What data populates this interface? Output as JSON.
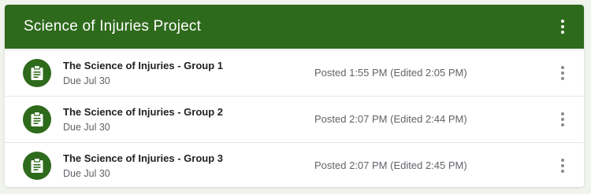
{
  "header": {
    "title": "Science of Injuries Project",
    "menu_icon": "more-vert-icon"
  },
  "colors": {
    "brand_green": "#2e6a1c",
    "background": "#f0f4ec"
  },
  "assignments": [
    {
      "title": "The Science of Injuries - Group 1",
      "due": "Due Jul 30",
      "posted": "Posted 1:55 PM (Edited 2:05 PM)",
      "icon": "assignment-icon"
    },
    {
      "title": "The Science of Injuries - Group 2",
      "due": "Due Jul 30",
      "posted": "Posted 2:07 PM (Edited 2:44 PM)",
      "icon": "assignment-icon"
    },
    {
      "title": "The Science of Injuries - Group 3",
      "due": "Due Jul 30",
      "posted": "Posted 2:07 PM (Edited 2:45 PM)",
      "icon": "assignment-icon"
    }
  ]
}
